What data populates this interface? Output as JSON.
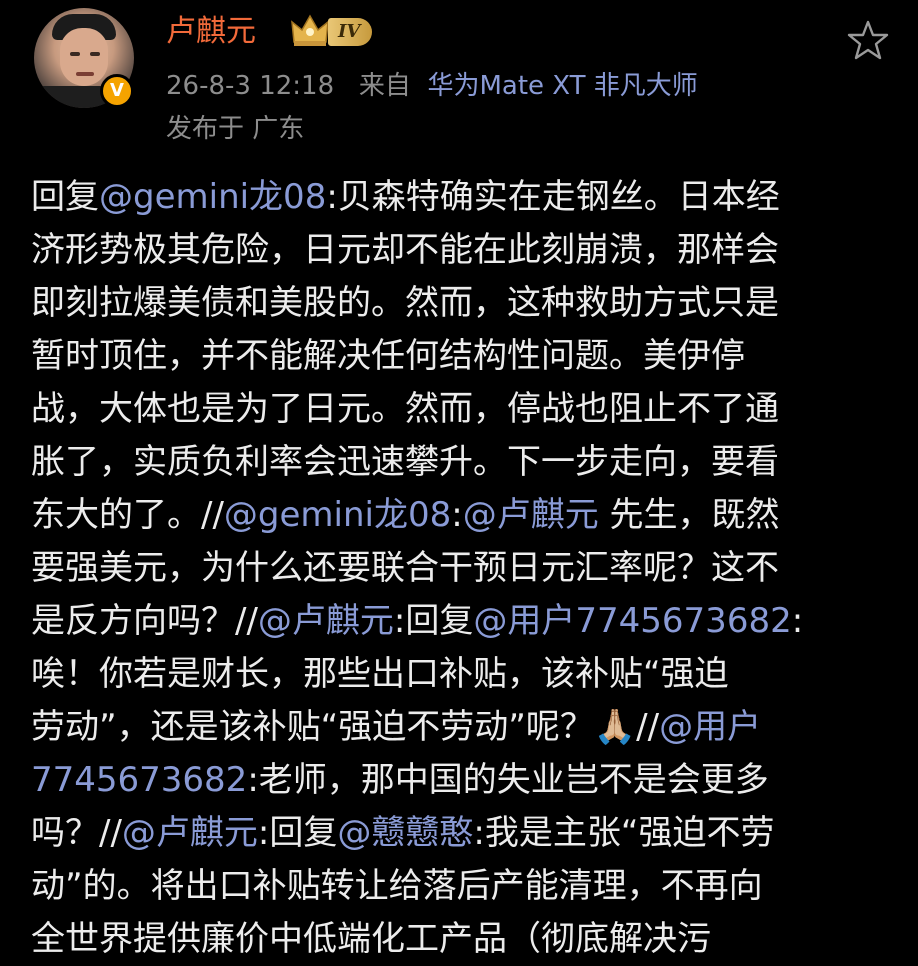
{
  "header": {
    "username": "卢麒元",
    "verified_badge": "V",
    "level": "IV",
    "time": "26-8-3 12:18",
    "source_prefix": "来自",
    "device": "华为Mate XT 非凡大师",
    "location": "发布于 广东",
    "icons": {
      "crown": "crown-icon",
      "star": "favorite-star-icon"
    }
  },
  "colors": {
    "background": "#000000",
    "username": "#f26a3a",
    "mention": "#8a9bd6",
    "text": "#ececec",
    "meta": "#8d8d8d"
  },
  "post": {
    "lines": [
      [
        {
          "t": "回复",
          "m": false
        },
        {
          "t": "@gemini龙08",
          "m": true
        },
        {
          "t": ":贝森特确实在走钢丝。日本经",
          "m": false
        }
      ],
      [
        {
          "t": "济形势极其危险，日元却不能在此刻崩溃，那样会",
          "m": false
        }
      ],
      [
        {
          "t": "即刻拉爆美债和美股的。然而，这种救助方式只是",
          "m": false
        }
      ],
      [
        {
          "t": "暂时顶住，并不能解决任何结构性问题。美伊停",
          "m": false
        }
      ],
      [
        {
          "t": "战，大体也是为了日元。然而，停战也阻止不了通",
          "m": false
        }
      ],
      [
        {
          "t": "胀了，实质负利率会迅速攀升。下一步走向，要看",
          "m": false
        }
      ],
      [
        {
          "t": "东大的了。//",
          "m": false
        },
        {
          "t": "@gemini龙08",
          "m": true
        },
        {
          "t": ":",
          "m": false
        },
        {
          "t": "@卢麒元",
          "m": true
        },
        {
          "t": " 先生，既然",
          "m": false
        }
      ],
      [
        {
          "t": "要强美元，为什么还要联合干预日元汇率呢？这不",
          "m": false
        }
      ],
      [
        {
          "t": "是反方向吗？//",
          "m": false
        },
        {
          "t": "@卢麒元",
          "m": true
        },
        {
          "t": ":回复",
          "m": false
        },
        {
          "t": "@用户7745673682",
          "m": true
        },
        {
          "t": ":",
          "m": false
        }
      ],
      [
        {
          "t": "唉！你若是财长，那些出口补贴，该补贴“强迫",
          "m": false
        }
      ],
      [
        {
          "t": "劳动”，还是该补贴“强迫不劳动”呢？🙏🏼//",
          "m": false
        },
        {
          "t": "@用户",
          "m": true
        }
      ],
      [
        {
          "t": "7745673682",
          "m": true
        },
        {
          "t": ":老师，那中国的失业岂不是会更多",
          "m": false
        }
      ],
      [
        {
          "t": "吗？//",
          "m": false
        },
        {
          "t": "@卢麒元",
          "m": true
        },
        {
          "t": ":回复",
          "m": false
        },
        {
          "t": "@戆戆憨",
          "m": true
        },
        {
          "t": ":我是主张“强迫不劳",
          "m": false
        }
      ],
      [
        {
          "t": "动”的。将出口补贴转让给落后产能清理，不再向",
          "m": false
        }
      ],
      [
        {
          "t": "全世界提供廉价中低端化工产品（彻底解决污",
          "m": false
        }
      ]
    ]
  }
}
